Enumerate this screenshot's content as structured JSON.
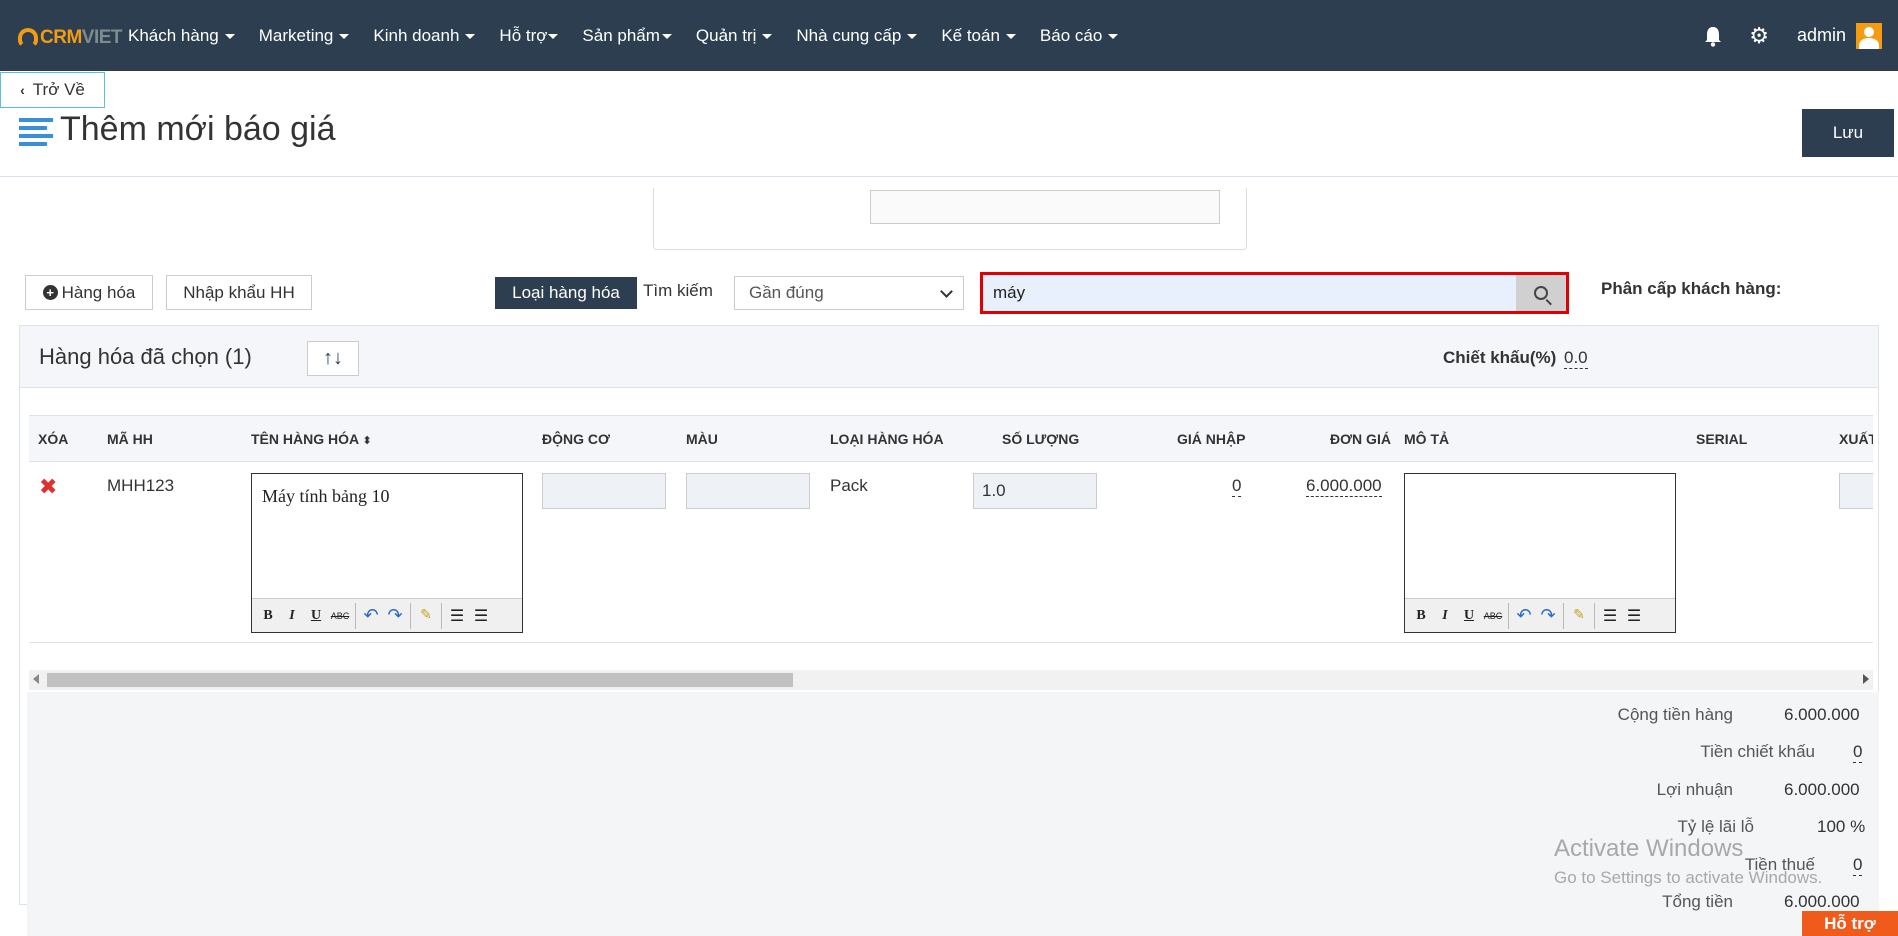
{
  "nav": {
    "logo_crm": "CRM",
    "logo_viet": "VIET",
    "menu": [
      "Khách hàng",
      "Marketing",
      "Kinh doanh",
      "Hỗ trợ",
      "Sản phẩm",
      "Quản trị",
      "Nhà cung cấp",
      "Kế toán",
      "Báo cáo"
    ],
    "user": "admin",
    "icons": [
      "bell-icon",
      "gear-icon",
      "avatar"
    ]
  },
  "header": {
    "back_label": "Trở Về",
    "title": "Thêm mới báo giá",
    "save_label": "Lưu"
  },
  "toolbar": {
    "add_item_label": "Hàng hóa",
    "import_label": "Nhập khẩu HH",
    "item_type_label": "Loại hàng hóa",
    "search_label": "Tìm kiếm",
    "match_mode": "Gần đúng",
    "search_value": "máy",
    "customer_level_label": "Phân cấp khách hàng:"
  },
  "panel": {
    "title": "Hàng hóa đã chọn (1)",
    "sort_label": "↑↓",
    "discount_label": "Chiết khấu(%)",
    "discount_value": "0.0"
  },
  "table": {
    "headers": [
      "XÓA",
      "MÃ HH",
      "TÊN HÀNG HÓA",
      "ĐỘNG CƠ",
      "MÀU",
      "LOẠI HÀNG HÓA",
      "SỐ LƯỢNG",
      "GIÁ NHẬP",
      "ĐƠN GIÁ",
      "MÔ TẢ",
      "SERIAL",
      "XUẤT"
    ],
    "sort_indicator": "⬍",
    "rows": [
      {
        "code": "MHH123",
        "name": "Máy tính bảng 10",
        "engine": "",
        "color": "",
        "type": "Pack",
        "quantity": "1.0",
        "import_price": "0",
        "unit_price": "6.000.000",
        "description": "",
        "serial": ""
      }
    ]
  },
  "totals": {
    "subtotal_label": "Cộng tiền hàng",
    "subtotal": "6.000.000",
    "discount_label": "Tiền chiết khấu",
    "discount": "0",
    "profit_label": "Lợi nhuận",
    "profit": "6.000.000",
    "margin_label": "Tỷ lệ lãi lỗ",
    "margin": "100 %",
    "tax_label": "Tiền thuế",
    "tax": "0",
    "total_label": "Tổng tiền",
    "total": "6.000.000"
  },
  "watermark": {
    "line1": "Activate Windows",
    "line2": "Go to Settings to activate Windows."
  },
  "support_label": "Hỗ trợ",
  "colors": {
    "navbar": "#2c3e50",
    "accent_orange": "#f39c12",
    "highlight_red": "#e00000",
    "support_orange": "#f05a1a"
  }
}
